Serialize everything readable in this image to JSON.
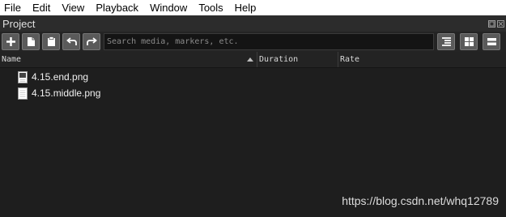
{
  "menubar": {
    "items": [
      "File",
      "Edit",
      "View",
      "Playback",
      "Window",
      "Tools",
      "Help"
    ]
  },
  "panel": {
    "title": "Project"
  },
  "toolbar": {
    "buttons": [
      {
        "icon": "add-icon"
      },
      {
        "icon": "copy-icon"
      },
      {
        "icon": "paste-icon"
      },
      {
        "icon": "undo-icon"
      },
      {
        "icon": "redo-icon"
      }
    ],
    "search_placeholder": "Search media, markers, etc.",
    "view_buttons": [
      {
        "icon": "list-view-icon"
      },
      {
        "icon": "grid-view-icon"
      },
      {
        "icon": "detail-view-icon"
      }
    ]
  },
  "table": {
    "columns": [
      "Name",
      "Duration",
      "Rate"
    ],
    "sort_column": "Name",
    "sort_direction": "ascending",
    "rows": [
      {
        "name": "4.15.end.png",
        "duration": "",
        "rate": ""
      },
      {
        "name": "4.15.middle.png",
        "duration": "",
        "rate": ""
      }
    ]
  },
  "watermark": "https://blog.csdn.net/whq12789",
  "colors": {
    "background": "#1e1e1e",
    "menubar": "#ffffff",
    "button": "#5a5a5a",
    "text": "#f0f0f0"
  }
}
